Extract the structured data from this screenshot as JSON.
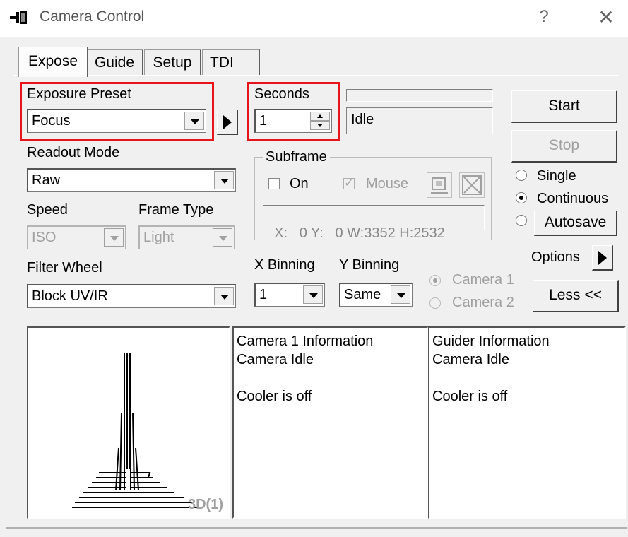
{
  "window": {
    "title": "Camera Control",
    "help_glyph": "?",
    "close_glyph": "✕"
  },
  "tabs": [
    {
      "label": "Expose",
      "active": true
    },
    {
      "label": "Guide",
      "active": false
    },
    {
      "label": "Setup",
      "active": false
    },
    {
      "label": "TDI",
      "active": false
    }
  ],
  "exposure": {
    "preset_label": "Exposure Preset",
    "preset_value": "Focus",
    "seconds_label": "Seconds",
    "seconds_value": "1",
    "status": "Idle"
  },
  "readout": {
    "label": "Readout Mode",
    "value": "Raw"
  },
  "speed": {
    "label": "Speed",
    "value": "ISO"
  },
  "frame_type": {
    "label": "Frame Type",
    "value": "Light"
  },
  "filter_wheel": {
    "label": "Filter Wheel",
    "value": "Block UV/IR"
  },
  "subframe": {
    "label": "Subframe",
    "on_label": "On",
    "on_checked": false,
    "mouse_label": "Mouse",
    "mouse_checked": true,
    "coords": "X:   0 Y:   0 W:3352 H:2532"
  },
  "binning": {
    "x_label": "X Binning",
    "x_value": "1",
    "y_label": "Y Binning",
    "y_value": "Same"
  },
  "camera_select": [
    {
      "label": "Camera 1",
      "selected": true
    },
    {
      "label": "Camera 2",
      "selected": false
    }
  ],
  "actions": {
    "start": "Start",
    "stop": "Stop",
    "options": "Options",
    "less": "Less <<"
  },
  "mode": [
    {
      "label": "Single",
      "selected": false
    },
    {
      "label": "Continuous",
      "selected": true
    },
    {
      "label": "Autosave",
      "selected": false
    }
  ],
  "preview": {
    "label": "3D(1)"
  },
  "camera_info": {
    "heading": "Camera 1 Information",
    "status": "Camera Idle",
    "cooler": "Cooler is off"
  },
  "guider_info": {
    "heading": "Guider Information",
    "status": "Camera Idle",
    "cooler": "Cooler is off"
  },
  "colors": {
    "highlight_red": "#e8141b",
    "dialog_bg": "#f0f0f0",
    "disabled_text": "#a0a0a0"
  }
}
